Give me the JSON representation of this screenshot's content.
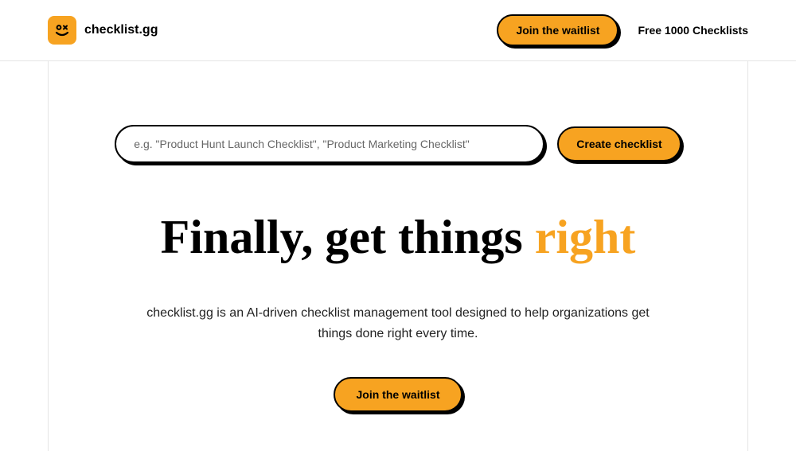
{
  "brand": {
    "name": "checklist.gg"
  },
  "header": {
    "waitlist_label": "Join the waitlist",
    "free_link_label": "Free 1000 Checklists"
  },
  "search": {
    "placeholder": "e.g. \"Product Hunt Launch Checklist\", \"Product Marketing Checklist\"",
    "create_label": "Create checklist"
  },
  "hero": {
    "title_prefix": "Finally, get things ",
    "title_highlight": "right",
    "subtitle": "checklist.gg is an AI-driven checklist management tool designed to help organizations get things done right every time.",
    "waitlist_label": "Join the waitlist"
  }
}
